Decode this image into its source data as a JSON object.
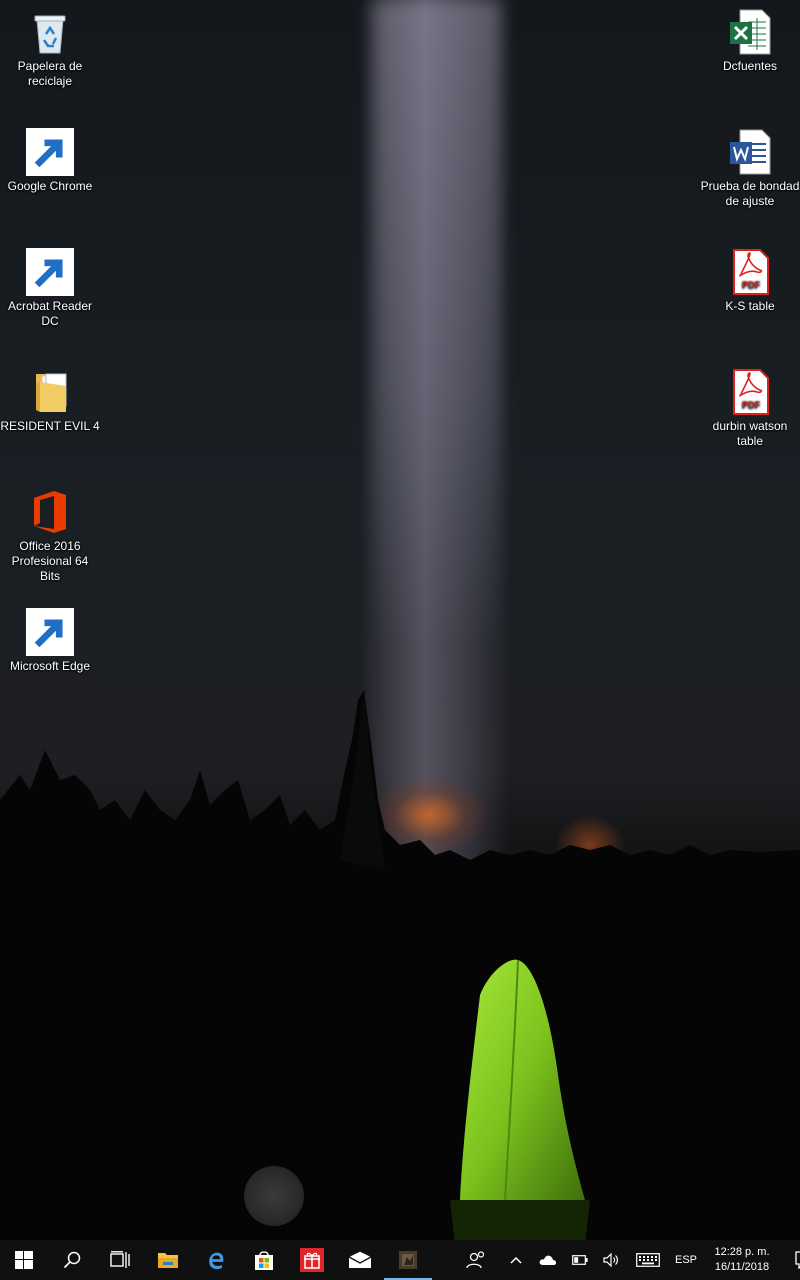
{
  "desktop": {
    "left_icons": [
      {
        "id": "recycle-bin",
        "label": "Papelera de reciclaje"
      },
      {
        "id": "google-chrome",
        "label": "Google Chrome"
      },
      {
        "id": "acrobat-reader",
        "label": "Acrobat Reader DC"
      },
      {
        "id": "resident-evil-folder",
        "label": "RESIDENT EVIL 4"
      },
      {
        "id": "office-2016",
        "label": "Office 2016 Profesional 64 Bits"
      },
      {
        "id": "microsoft-edge",
        "label": "Microsoft Edge"
      }
    ],
    "right_icons": [
      {
        "id": "dcfuentes-excel",
        "label": "Dcfuentes"
      },
      {
        "id": "prueba-word",
        "label": "Prueba de bondad de ajuste"
      },
      {
        "id": "ks-table-pdf",
        "label": "K-S table"
      },
      {
        "id": "durbin-watson-pdf",
        "label": "durbin watson table"
      }
    ]
  },
  "taskbar": {
    "buttons": [
      "start-icon",
      "search-icon",
      "task-view-icon",
      "file-explorer-icon",
      "edge-icon",
      "store-icon",
      "gift-app-icon",
      "mail-icon",
      "game-app-icon"
    ],
    "active_button": "game-app-icon",
    "tray": {
      "language": "ESP",
      "time": "12:28 p. m.",
      "date": "16/11/2018"
    }
  },
  "colors": {
    "taskbar_bg": "#101010",
    "active_indicator": "#76b9ed",
    "excel_green": "#1e7145",
    "word_blue": "#2b579a",
    "pdf_red": "#e02020",
    "office_orange": "#eb3c00",
    "edge_blue": "#0078d7",
    "tent_green": "#8bd12a"
  }
}
